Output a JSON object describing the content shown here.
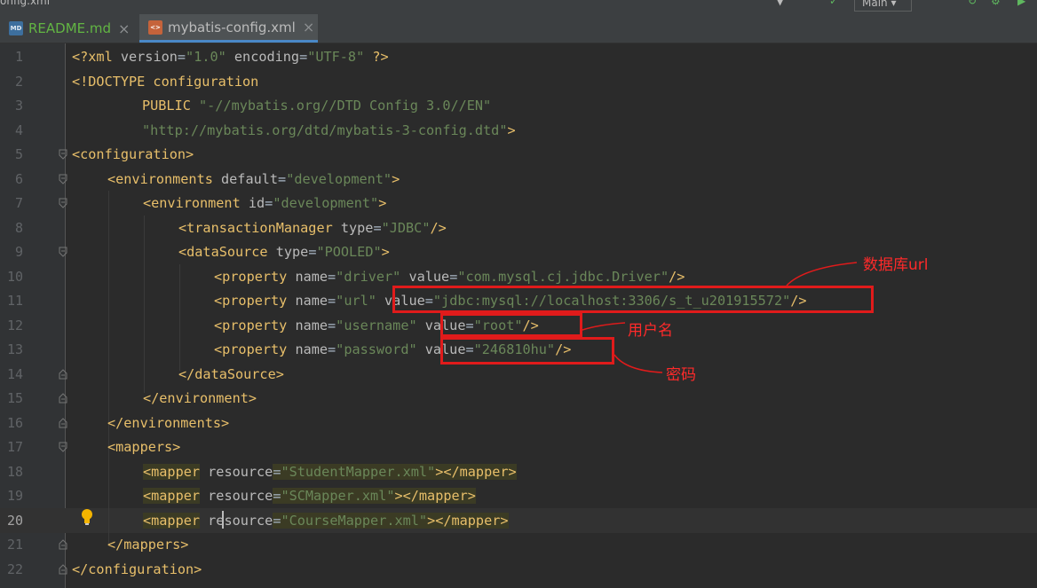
{
  "window": {
    "title_fragment": "onfig.xml",
    "right_controls": {
      "branch_label": "Main"
    }
  },
  "tabs": [
    {
      "label": "README.md",
      "icon": "markdown-file-icon",
      "active": false
    },
    {
      "label": "mybatis-config.xml",
      "icon": "xml-file-icon",
      "active": true
    }
  ],
  "editor": {
    "current_line": "20",
    "lines": [
      {
        "n": "1"
      },
      {
        "n": "2"
      },
      {
        "n": "3"
      },
      {
        "n": "4"
      },
      {
        "n": "5"
      },
      {
        "n": "6"
      },
      {
        "n": "7"
      },
      {
        "n": "8"
      },
      {
        "n": "9"
      },
      {
        "n": "10"
      },
      {
        "n": "11"
      },
      {
        "n": "12"
      },
      {
        "n": "13"
      },
      {
        "n": "14"
      },
      {
        "n": "15"
      },
      {
        "n": "16"
      },
      {
        "n": "17"
      },
      {
        "n": "18"
      },
      {
        "n": "19"
      },
      {
        "n": "20"
      },
      {
        "n": "21"
      },
      {
        "n": "22"
      }
    ],
    "code": {
      "l1": {
        "decl": "<?xml ",
        "a1": "version",
        "eq1": "=",
        "v1": "\"1.0\"",
        "a2": " encoding",
        "eq2": "=",
        "v2": "\"UTF-8\"",
        "end": " ?>"
      },
      "l2": {
        "text": "<!DOCTYPE configuration"
      },
      "l3": {
        "kw": "PUBLIC ",
        "v": "\"-//mybatis.org//DTD Config 3.0//EN\""
      },
      "l4": {
        "v": "\"http://mybatis.org/dtd/mybatis-3-config.dtd\"",
        "end": ">"
      },
      "l5": {
        "tag": "<configuration>"
      },
      "l6": {
        "tag": "<environments ",
        "a": "default",
        "eq": "=",
        "v": "\"development\"",
        "end": ">"
      },
      "l7": {
        "tag": "<environment ",
        "a": "id",
        "eq": "=",
        "v": "\"development\"",
        "end": ">"
      },
      "l8": {
        "tag": "<transactionManager ",
        "a": "type",
        "eq": "=",
        "v": "\"JDBC\"",
        "end": "/>"
      },
      "l9": {
        "tag": "<dataSource ",
        "a": "type",
        "eq": "=",
        "v": "\"POOLED\"",
        "end": ">"
      },
      "l10": {
        "tag": "<property ",
        "a1": "name",
        "eq1": "=",
        "v1": "\"driver\"",
        "a2": " value",
        "eq2": "=",
        "v2": "\"com.mysql.cj.jdbc.Driver\"",
        "end": "/>"
      },
      "l11": {
        "tag": "<property ",
        "a1": "name",
        "eq1": "=",
        "v1": "\"url\"",
        "a2": " value",
        "eq2": "=",
        "v2": "\"jdbc:mysql://localhost:3306/s_t_u201915572\"",
        "end": "/>"
      },
      "l12": {
        "tag": "<property ",
        "a1": "name",
        "eq1": "=",
        "v1": "\"username\"",
        "a2": " value",
        "eq2": "=",
        "v2": "\"root\"",
        "end": "/>"
      },
      "l13": {
        "tag": "<property ",
        "a1": "name",
        "eq1": "=",
        "v1": "\"password\"",
        "a2": " value",
        "eq2": "=",
        "v2": "\"246810hu\"",
        "end": "/>"
      },
      "l14": {
        "tag": "</dataSource>"
      },
      "l15": {
        "tag": "</environment>"
      },
      "l16": {
        "tag": "</environments>"
      },
      "l17": {
        "tag": "<mappers>"
      },
      "l18": {
        "tag": "<mapper",
        "a": " resource",
        "eq": "=",
        "v": "\"StudentMapper.xml\"",
        "end": "></mapper>"
      },
      "l19": {
        "tag": "<mapper",
        "a": " resource",
        "eq": "=",
        "v": "\"SCMapper.xml\"",
        "end": "></mapper>"
      },
      "l20": {
        "tag": "<mapper",
        "a": " resource",
        "eq": "=",
        "v": "\"CourseMapper.xml\"",
        "end": "></mapper>"
      },
      "l21": {
        "tag": "</mappers>"
      },
      "l22": {
        "tag": "</configuration>"
      }
    }
  },
  "annotations": {
    "url": "数据库url",
    "username": "用户名",
    "password": "密码"
  },
  "colors": {
    "annotation": "#e01b1b",
    "tag": "#e8bf6a",
    "value": "#6a8759",
    "background": "#2b2b2b"
  }
}
